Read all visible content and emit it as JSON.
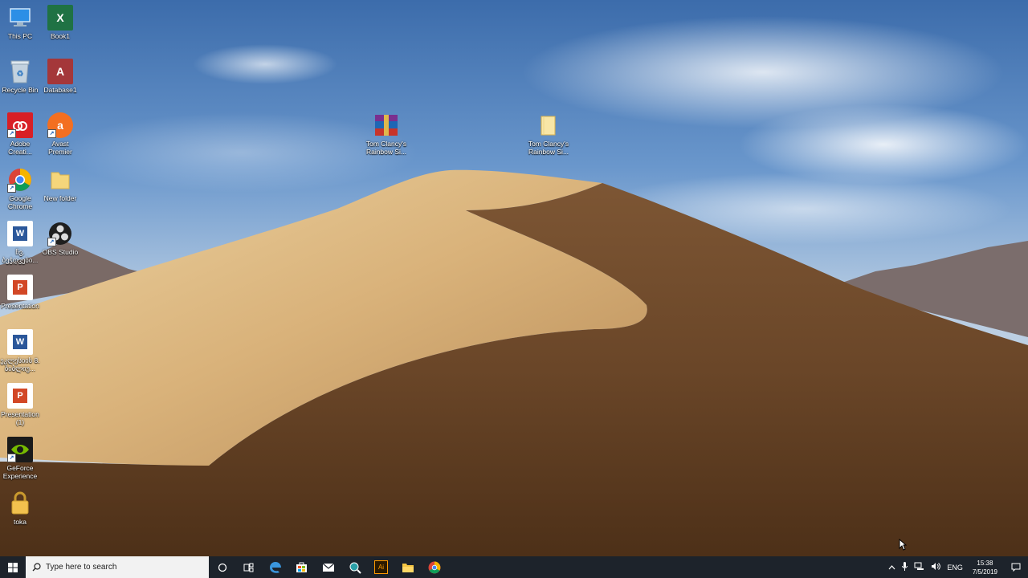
{
  "desktop_icons": [
    {
      "label": "This PC",
      "icon": "this-pc-icon",
      "color": "#2c8fe6"
    },
    {
      "label": "Book1",
      "icon": "excel-icon",
      "color": "#1f7244"
    },
    {
      "label": "Recycle Bin",
      "icon": "recycle-bin-icon",
      "color": "#8fa7c0"
    },
    {
      "label": "Database1",
      "icon": "access-icon",
      "color": "#a4373a"
    },
    {
      "label": "Adobe Creati...",
      "icon": "adobe-cc-icon",
      "color": "#d81f26"
    },
    {
      "label": "Avast Premier",
      "icon": "avast-icon",
      "color": "#f36f21"
    },
    {
      "label": "Google Chrome",
      "icon": "chrome-icon",
      "color": "#db4437"
    },
    {
      "label": "New folder",
      "icon": "folder-icon",
      "color": "#f5d67b"
    },
    {
      "label": "ჩვ. ბეჭდვები...",
      "icon": "word-icon",
      "color": "#2b579a"
    },
    {
      "label": "OBS Studio",
      "icon": "obs-icon",
      "color": "#1f1f1f"
    },
    {
      "label": "Presentation",
      "icon": "powerpoint-icon",
      "color": "#d24726"
    },
    {
      "label": "ეკლესიის 8. ბიბლიუ...",
      "icon": "word-icon",
      "color": "#2b579a"
    },
    {
      "label": "Presentation (1)",
      "icon": "powerpoint-icon",
      "color": "#d24726"
    },
    {
      "label": "GeForce Experience",
      "icon": "geforce-icon",
      "color": "#76b900"
    },
    {
      "label": "toka",
      "icon": "lock-folder-icon",
      "color": "#f2c14e"
    },
    {
      "label": "Tom Clancy's Rainbow Si...",
      "icon": "winrar-icon",
      "color": "#7a2f8f"
    },
    {
      "label": "Tom Clancy's Rainbow Si...",
      "icon": "folder-icon",
      "color": "#f5d67b"
    }
  ],
  "taskbar": {
    "search_placeholder": "Type here to search",
    "apps": [
      "cortana-icon",
      "task-view-icon",
      "edge-icon",
      "store-icon",
      "mail-icon",
      "search-app-icon",
      "illustrator-icon",
      "file-explorer-icon",
      "chrome-icon"
    ],
    "tray": {
      "language": "ENG",
      "time": "15:38",
      "date": "7/5/2019"
    }
  }
}
